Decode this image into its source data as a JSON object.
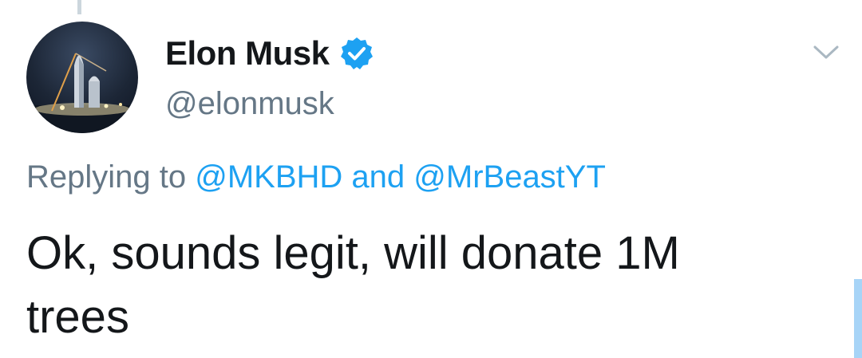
{
  "author": {
    "display_name": "Elon Musk",
    "handle": "@elonmusk",
    "verified": true,
    "avatar_icon": "starship-avatar"
  },
  "reply": {
    "prefix": "Replying to ",
    "mention_1": "@MKBHD",
    "conjunction": " and ",
    "mention_2": "@MrBeastYT"
  },
  "tweet": {
    "text": "Ok, sounds legit, will donate 1M trees"
  },
  "icons": {
    "verified": "verified-badge-icon",
    "menu": "chevron-down-icon"
  },
  "colors": {
    "accent": "#1da1f2",
    "secondary_text": "#657786",
    "primary_text": "#14171a"
  }
}
